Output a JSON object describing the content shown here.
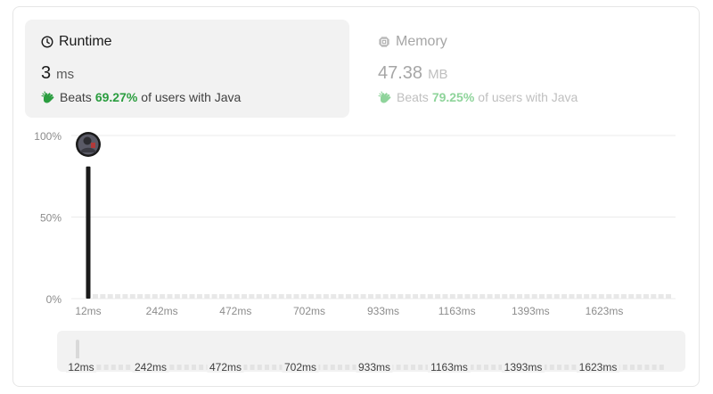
{
  "runtime": {
    "label": "Runtime",
    "value": "3",
    "unit": "ms",
    "beats_prefix": "Beats",
    "beats_pct": "69.27%",
    "beats_suffix": "of users with Java",
    "icon": "clock-icon"
  },
  "memory": {
    "label": "Memory",
    "value": "47.38",
    "unit": "MB",
    "beats_prefix": "Beats",
    "beats_pct": "79.25%",
    "beats_suffix": "of users with Java",
    "icon": "chip-icon"
  },
  "colors": {
    "accent_green": "#2a9d3f",
    "bar": "#1a1a1a",
    "grid": "#ebebeb",
    "muted": "#a6a6a6"
  },
  "chart_data": {
    "type": "bar",
    "title": "",
    "xlabel": "",
    "ylabel": "",
    "y_ticks": [
      "100%",
      "50%",
      "0%"
    ],
    "ylim": [
      0,
      100
    ],
    "x_tick_labels": [
      "12ms",
      "242ms",
      "472ms",
      "702ms",
      "933ms",
      "1163ms",
      "1393ms",
      "1623ms"
    ],
    "x_tick_values": [
      12,
      242,
      472,
      702,
      933,
      1163,
      1393,
      1623
    ],
    "xlim": [
      3,
      1849
    ],
    "highlighted_bar": {
      "x": 3,
      "value": 81
    },
    "other_bars_value": 1,
    "other_bars_count": 78,
    "range_selector": {
      "x_tick_labels": [
        "12ms",
        "242ms",
        "472ms",
        "702ms",
        "933ms",
        "1163ms",
        "1393ms",
        "1623ms"
      ]
    }
  }
}
